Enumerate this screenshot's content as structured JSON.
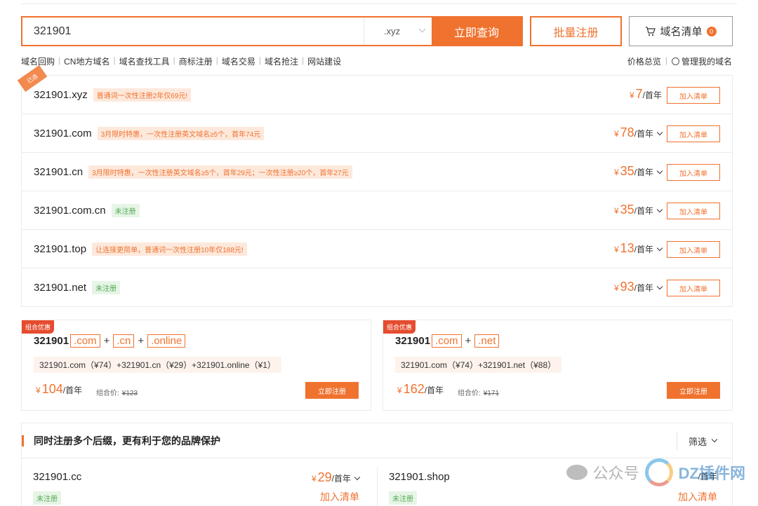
{
  "search": {
    "query": "321901",
    "suffix": ".xyz",
    "search_label": "立即查询",
    "bulk_label": "批量注册",
    "cart_label": "域名清单",
    "cart_count": "0"
  },
  "nav": {
    "left": [
      "域名回购",
      "CN地方域名",
      "域名查找工具",
      "商标注册",
      "域名交易",
      "域名抢注",
      "网站建设"
    ],
    "right_price": "价格总览",
    "right_manage": "管理我的域名"
  },
  "results": [
    {
      "domain": "321901.xyz",
      "tag": "普通词一次性注册2年仅69元!",
      "tag_type": "promo",
      "price": "7",
      "unit": "/首年",
      "dropdown": false,
      "add": "加入清单",
      "ribbon": "已选"
    },
    {
      "domain": "321901.com",
      "tag": "3月限时特惠，一次性注册英文域名≥5个，首年74元",
      "tag_type": "promo",
      "price": "78",
      "unit": "/首年",
      "dropdown": true,
      "add": "加入清单"
    },
    {
      "domain": "321901.cn",
      "tag": "3月限时特惠，一次性注册英文域名≥5个，首年29元；一次性注册≥20个，首年27元",
      "tag_type": "promo",
      "price": "35",
      "unit": "/首年",
      "dropdown": true,
      "add": "加入清单"
    },
    {
      "domain": "321901.com.cn",
      "tag": "未注册",
      "tag_type": "free",
      "price": "35",
      "unit": "/首年",
      "dropdown": true,
      "add": "加入清单"
    },
    {
      "domain": "321901.top",
      "tag": "让连接更简单，普通词一次性注册10年仅188元!",
      "tag_type": "promo",
      "price": "13",
      "unit": "/首年",
      "dropdown": true,
      "add": "加入清单"
    },
    {
      "domain": "321901.net",
      "tag": "未注册",
      "tag_type": "free",
      "price": "93",
      "unit": "/首年",
      "dropdown": true,
      "add": "加入清单"
    }
  ],
  "currency": "¥",
  "bundles": [
    {
      "badge": "组合优惠",
      "name": "321901",
      "suffixes": [
        ".com",
        ".cn",
        ".online"
      ],
      "detail": "321901.com（¥74）+321901.cn（¥29）+321901.online（¥1）",
      "price": "104",
      "unit": "/首年",
      "orig_label": "组合价:",
      "orig_price": "¥123",
      "button": "立即注册"
    },
    {
      "badge": "组合优惠",
      "name": "321901",
      "suffixes": [
        ".com",
        ".net"
      ],
      "detail": "321901.com（¥74）+321901.net（¥88）",
      "price": "162",
      "unit": "/首年",
      "orig_label": "组合价:",
      "orig_price": "¥171",
      "button": "立即注册"
    }
  ],
  "multi": {
    "title": "同时注册多个后缀，更有利于您的品牌保护",
    "filter": "筛选",
    "items": [
      {
        "domain": "321901.cc",
        "tag": "未注册",
        "price": "29",
        "unit": "/首年",
        "add": "加入清单"
      },
      {
        "domain": "321901.shop",
        "tag": "未注册",
        "price": "",
        "unit": "/首年",
        "add": "加入清单"
      }
    ]
  },
  "watermark": {
    "left": "公众号",
    "right": "DZ插件网"
  },
  "colors": {
    "accent": "#f0722f",
    "free_tag": "#56a956",
    "bundle_badge": "#e54c2f"
  }
}
